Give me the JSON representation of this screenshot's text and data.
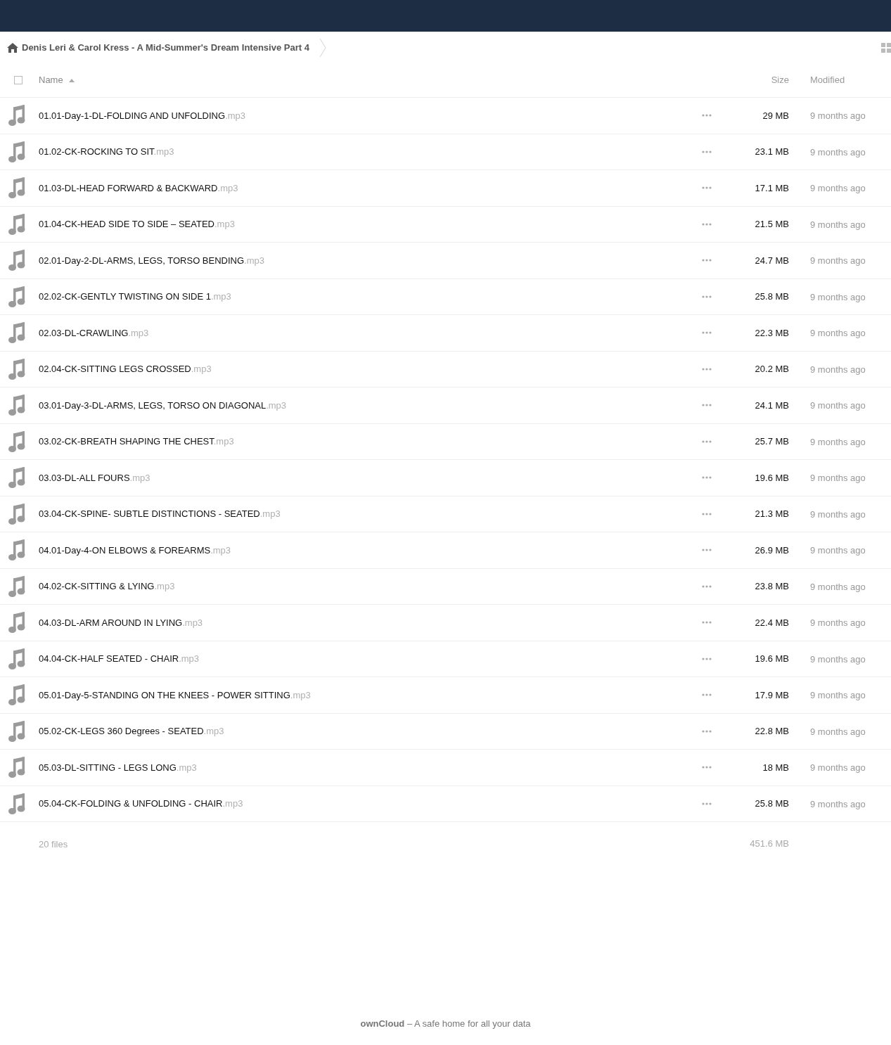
{
  "breadcrumb": {
    "items": [
      {
        "label": "Denis Leri & Carol Kress - A Mid-Summer's Dream Intensive Part 4"
      }
    ]
  },
  "table": {
    "select_all": {
      "checked": false
    },
    "columns": [
      {
        "label": "Name",
        "sorted": true
      },
      {
        "label": "Size",
        "sorted": false
      },
      {
        "label": "Modified",
        "sorted": false
      }
    ],
    "rows": [
      {
        "name": "01.01-Day-1-DL-FOLDING AND UNFOLDING",
        "extension": ".mp3",
        "size": "29 MB",
        "modified": "9 months ago"
      },
      {
        "name": "01.02-CK-ROCKING TO SIT",
        "extension": ".mp3",
        "size": "23.1 MB",
        "modified": "9 months ago"
      },
      {
        "name": "01.03-DL-HEAD FORWARD & BACKWARD",
        "extension": ".mp3",
        "size": "17.1 MB",
        "modified": "9 months ago"
      },
      {
        "name": "01.04-CK-HEAD SIDE TO SIDE – SEATED",
        "extension": ".mp3",
        "size": "21.5 MB",
        "modified": "9 months ago"
      },
      {
        "name": "02.01-Day-2-DL-ARMS, LEGS, TORSO BENDING",
        "extension": ".mp3",
        "size": "24.7 MB",
        "modified": "9 months ago"
      },
      {
        "name": "02.02-CK-GENTLY TWISTING ON SIDE 1",
        "extension": ".mp3",
        "size": "25.8 MB",
        "modified": "9 months ago"
      },
      {
        "name": "02.03-DL-CRAWLING",
        "extension": ".mp3",
        "size": "22.3 MB",
        "modified": "9 months ago"
      },
      {
        "name": "02.04-CK-SITTING LEGS CROSSED",
        "extension": ".mp3",
        "size": "20.2 MB",
        "modified": "9 months ago"
      },
      {
        "name": "03.01-Day-3-DL-ARMS, LEGS, TORSO ON DIAGONAL",
        "extension": ".mp3",
        "size": "24.1 MB",
        "modified": "9 months ago"
      },
      {
        "name": "03.02-CK-BREATH SHAPING THE CHEST",
        "extension": ".mp3",
        "size": "25.7 MB",
        "modified": "9 months ago"
      },
      {
        "name": "03.03-DL-ALL FOURS",
        "extension": ".mp3",
        "size": "19.6 MB",
        "modified": "9 months ago"
      },
      {
        "name": "03.04-CK-SPINE- SUBTLE DISTINCTIONS - SEATED",
        "extension": ".mp3",
        "size": "21.3 MB",
        "modified": "9 months ago"
      },
      {
        "name": "04.01-Day-4-ON ELBOWS & FOREARMS",
        "extension": ".mp3",
        "size": "26.9 MB",
        "modified": "9 months ago"
      },
      {
        "name": "04.02-CK-SITTING & LYING",
        "extension": ".mp3",
        "size": "23.8 MB",
        "modified": "9 months ago"
      },
      {
        "name": "04.03-DL-ARM AROUND IN LYING",
        "extension": ".mp3",
        "size": "22.4 MB",
        "modified": "9 months ago"
      },
      {
        "name": "04.04-CK-HALF SEATED - CHAIR",
        "extension": ".mp3",
        "size": "19.6 MB",
        "modified": "9 months ago"
      },
      {
        "name": "05.01-Day-5-STANDING ON THE KNEES - POWER SITTING",
        "extension": ".mp3",
        "size": "17.9 MB",
        "modified": "9 months ago"
      },
      {
        "name": "05.02-CK-LEGS 360 Degrees - SEATED",
        "extension": ".mp3",
        "size": "22.8 MB",
        "modified": "9 months ago"
      },
      {
        "name": "05.03-DL-SITTING - LEGS LONG",
        "extension": ".mp3",
        "size": "18 MB",
        "modified": "9 months ago"
      },
      {
        "name": "05.04-CK-FOLDING & UNFOLDING - CHAIR",
        "extension": ".mp3",
        "size": "25.8 MB",
        "modified": "9 months ago"
      }
    ],
    "summary": {
      "files": "20 files",
      "size": "451.6 MB"
    }
  },
  "footer": {
    "tagline": "**ownCloud** – A safe home for all your data"
  }
}
